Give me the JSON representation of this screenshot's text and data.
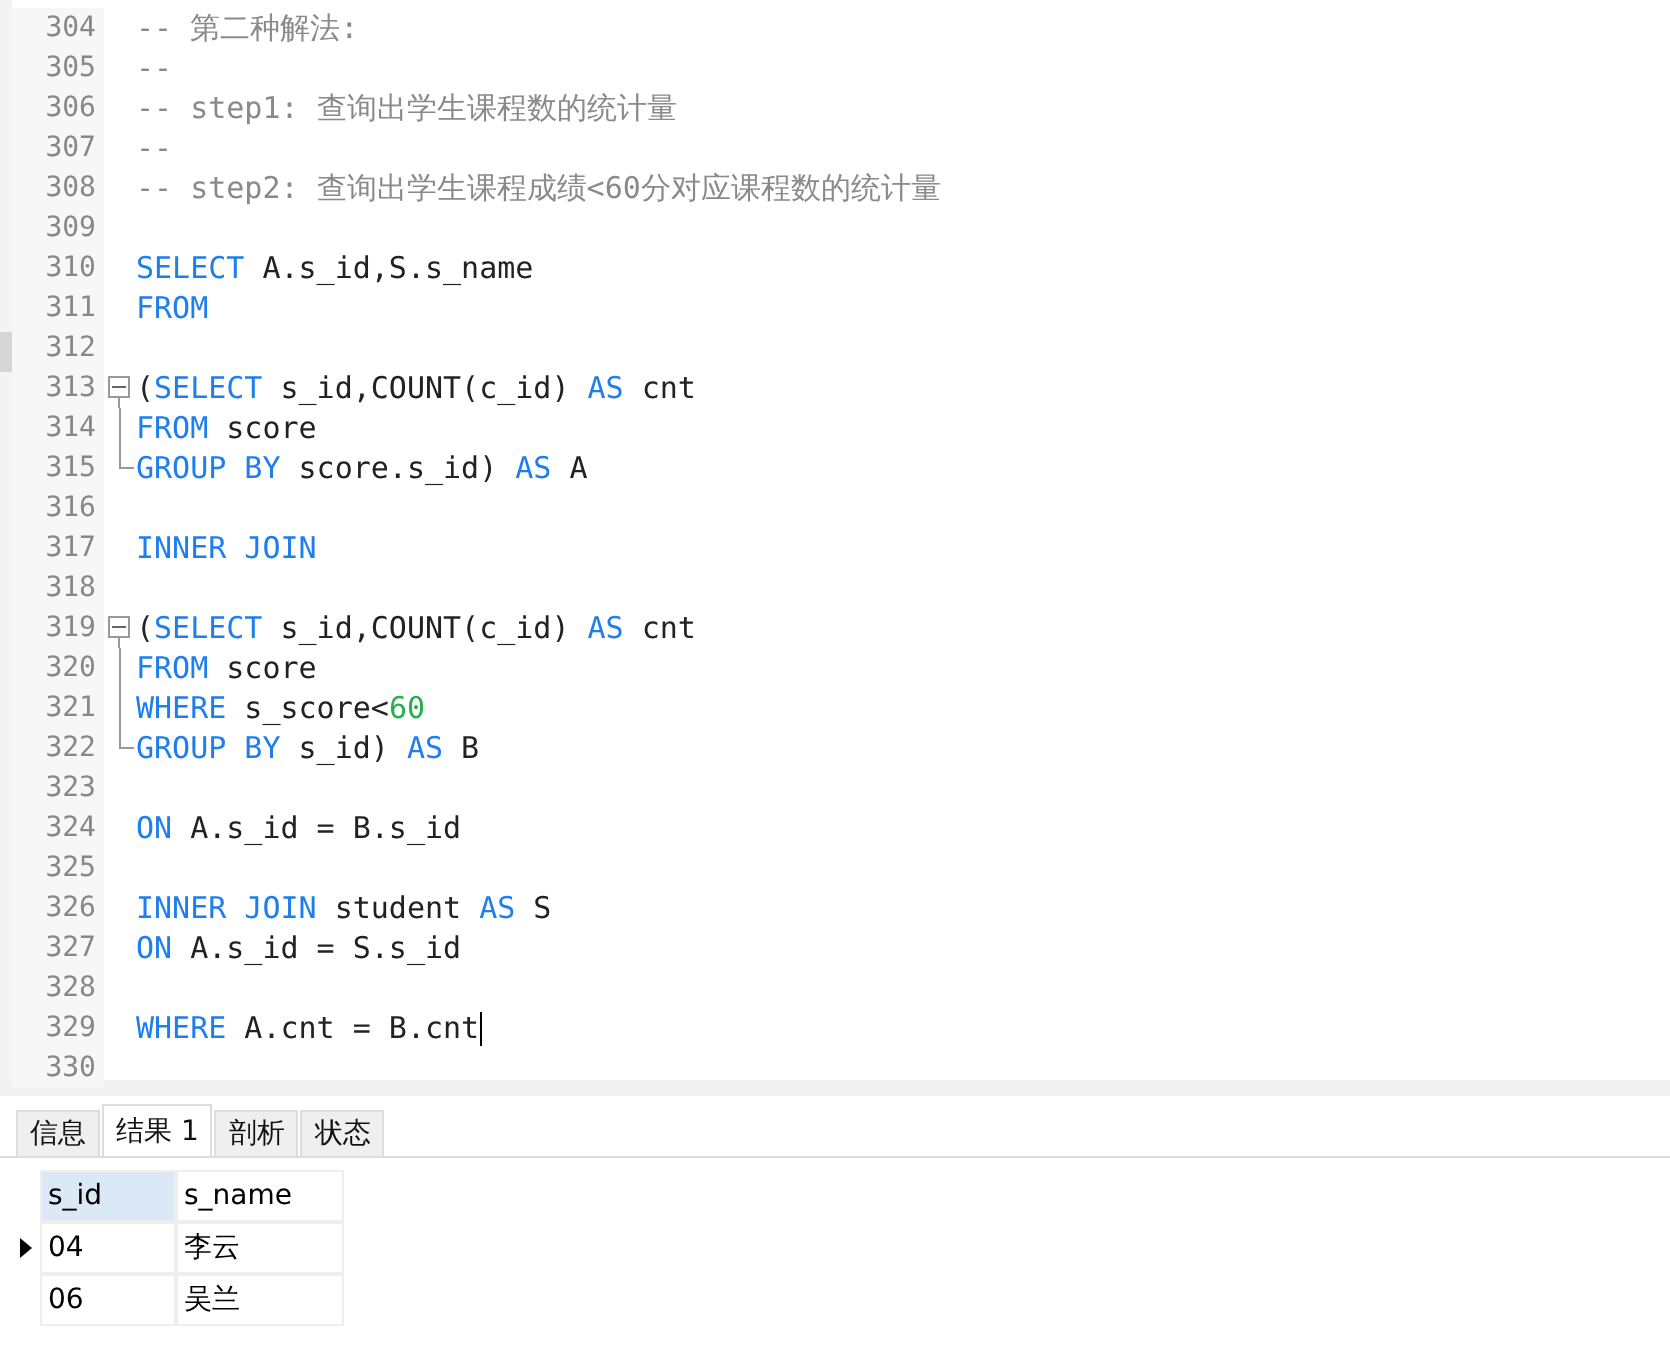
{
  "editor": {
    "lines": [
      {
        "number": "304",
        "kind": "plain",
        "tokens": [
          {
            "kind": "comment",
            "text": "-- 第二种解法:"
          }
        ]
      },
      {
        "number": "305",
        "kind": "plain",
        "tokens": [
          {
            "kind": "comment",
            "text": "--"
          }
        ]
      },
      {
        "number": "306",
        "kind": "plain",
        "tokens": [
          {
            "kind": "comment",
            "text": "-- step1: 查询出学生课程数的统计量"
          }
        ]
      },
      {
        "number": "307",
        "kind": "plain",
        "tokens": [
          {
            "kind": "comment",
            "text": "--"
          }
        ]
      },
      {
        "number": "308",
        "kind": "plain",
        "tokens": [
          {
            "kind": "comment",
            "text": "-- step2: 查询出学生课程成绩<60分对应课程数的统计量"
          }
        ]
      },
      {
        "number": "309",
        "kind": "plain"
      },
      {
        "number": "310",
        "kind": "plain",
        "tokens": [
          {
            "kind": "keyword",
            "text": "SELECT"
          },
          {
            "kind": "plain",
            "text": " A.s_id,S.s_name"
          }
        ]
      },
      {
        "number": "311",
        "kind": "plain",
        "tokens": [
          {
            "kind": "keyword",
            "text": "FROM"
          }
        ]
      },
      {
        "number": "312",
        "kind": "plain"
      },
      {
        "number": "313",
        "kind": "foldstart",
        "tokens": [
          {
            "kind": "plain",
            "text": "("
          },
          {
            "kind": "keyword",
            "text": "SELECT"
          },
          {
            "kind": "plain",
            "text": " s_id,COUNT(c_id) "
          },
          {
            "kind": "keyword",
            "text": "AS"
          },
          {
            "kind": "plain",
            "text": " cnt"
          }
        ]
      },
      {
        "number": "314",
        "kind": "foldbody",
        "tokens": [
          {
            "kind": "keyword",
            "text": "FROM"
          },
          {
            "kind": "plain",
            "text": " score"
          }
        ]
      },
      {
        "number": "315",
        "kind": "foldend",
        "tokens": [
          {
            "kind": "keyword",
            "text": "GROUP BY"
          },
          {
            "kind": "plain",
            "text": " score.s_id) "
          },
          {
            "kind": "keyword",
            "text": "AS"
          },
          {
            "kind": "plain",
            "text": " A"
          }
        ]
      },
      {
        "number": "316",
        "kind": "plain"
      },
      {
        "number": "317",
        "kind": "plain",
        "tokens": [
          {
            "kind": "keyword",
            "text": "INNER JOIN"
          }
        ]
      },
      {
        "number": "318",
        "kind": "plain"
      },
      {
        "number": "319",
        "kind": "foldstart",
        "tokens": [
          {
            "kind": "plain",
            "text": "("
          },
          {
            "kind": "keyword",
            "text": "SELECT"
          },
          {
            "kind": "plain",
            "text": " s_id,COUNT(c_id) "
          },
          {
            "kind": "keyword",
            "text": "AS"
          },
          {
            "kind": "plain",
            "text": " cnt"
          }
        ]
      },
      {
        "number": "320",
        "kind": "foldbody",
        "tokens": [
          {
            "kind": "keyword",
            "text": "FROM"
          },
          {
            "kind": "plain",
            "text": " score"
          }
        ]
      },
      {
        "number": "321",
        "kind": "foldbody",
        "tokens": [
          {
            "kind": "keyword",
            "text": "WHERE"
          },
          {
            "kind": "plain",
            "text": " s_score<"
          },
          {
            "kind": "number",
            "text": "60"
          }
        ]
      },
      {
        "number": "322",
        "kind": "foldend",
        "tokens": [
          {
            "kind": "keyword",
            "text": "GROUP BY"
          },
          {
            "kind": "plain",
            "text": " s_id) "
          },
          {
            "kind": "keyword",
            "text": "AS"
          },
          {
            "kind": "plain",
            "text": " B"
          }
        ]
      },
      {
        "number": "323",
        "kind": "plain"
      },
      {
        "number": "324",
        "kind": "plain",
        "tokens": [
          {
            "kind": "keyword",
            "text": "ON"
          },
          {
            "kind": "plain",
            "text": " A.s_id = B.s_id"
          }
        ]
      },
      {
        "number": "325",
        "kind": "plain"
      },
      {
        "number": "326",
        "kind": "plain",
        "tokens": [
          {
            "kind": "keyword",
            "text": "INNER JOIN"
          },
          {
            "kind": "plain",
            "text": " student "
          },
          {
            "kind": "keyword",
            "text": "AS"
          },
          {
            "kind": "plain",
            "text": " S"
          }
        ]
      },
      {
        "number": "327",
        "kind": "plain",
        "tokens": [
          {
            "kind": "keyword",
            "text": "ON"
          },
          {
            "kind": "plain",
            "text": " A.s_id = S.s_id"
          }
        ]
      },
      {
        "number": "328",
        "kind": "plain"
      },
      {
        "number": "329",
        "kind": "plain",
        "cursor": true,
        "tokens": [
          {
            "kind": "keyword",
            "text": "WHERE"
          },
          {
            "kind": "plain",
            "text": " A.cnt = B.cnt"
          }
        ]
      },
      {
        "number": "330",
        "kind": "plain"
      }
    ]
  },
  "result_tabs": [
    {
      "label": "信息",
      "selected": false
    },
    {
      "label": "结果 1",
      "selected": true
    },
    {
      "label": "剖析",
      "selected": false
    },
    {
      "label": "状态",
      "selected": false
    }
  ],
  "result_table": {
    "columns": [
      {
        "label": "s_id",
        "selected": true
      },
      {
        "label": "s_name",
        "selected": false
      }
    ],
    "rows": [
      {
        "selected": true,
        "cells": [
          "04",
          "李云"
        ]
      },
      {
        "selected": false,
        "cells": [
          "06",
          "吴兰"
        ]
      }
    ]
  }
}
